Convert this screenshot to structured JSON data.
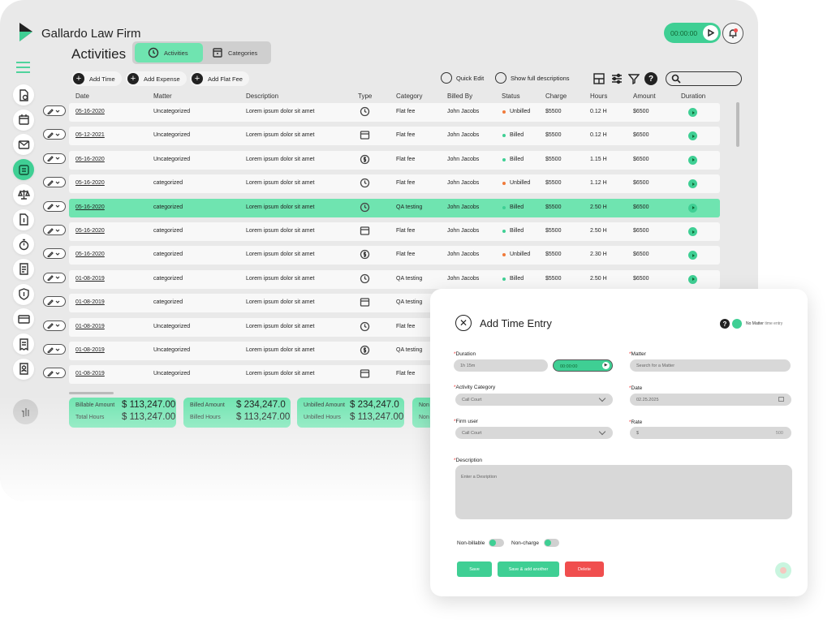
{
  "app": {
    "firm_name": "Gallardo Law Firm",
    "page_title": "Activities"
  },
  "tabs": [
    {
      "label": "Activities",
      "icon": "clock-refresh-icon",
      "active": true
    },
    {
      "label": "Categories",
      "icon": "archive-icon",
      "active": false
    }
  ],
  "timer": {
    "value": "00:00:00"
  },
  "sidebar": {
    "icons": [
      "file-clock-icon",
      "calendar-icon",
      "mail-icon",
      "activities-icon",
      "scales-icon",
      "file-dollar-icon",
      "stopwatch-icon",
      "document-icon",
      "shield-dollar-icon",
      "card-dollar-icon",
      "invoice-icon",
      "file-user-icon"
    ],
    "active_index": 3
  },
  "toolbar": {
    "add_time": "Add Time",
    "add_expense": "Add Expense",
    "add_flat_fee": "Add Flat Fee",
    "quick_edit": "Quick Edit",
    "show_full": "Show full descriptions",
    "search_placeholder": ""
  },
  "columns": [
    "Date",
    "Matter",
    "Description",
    "Type",
    "Category",
    "Billed By",
    "Status",
    "Charge",
    "Hours",
    "Amount",
    "Duration"
  ],
  "rows": [
    {
      "date": "05-16-2020",
      "matter": "Uncategorized",
      "description": "Lorem ipsum dolor sit amet",
      "type": "history",
      "category": "Flat fee",
      "billed_by": "John Jacobs",
      "status": "Unbilled",
      "charge": "$5500",
      "hours": "0.12 H",
      "amount": "$6500"
    },
    {
      "date": "05-12-2021",
      "matter": "Uncategorized",
      "description": "Lorem ipsum dolor sit amet",
      "type": "archive",
      "category": "Flat fee",
      "billed_by": "John Jacobs",
      "status": "Billed",
      "charge": "$5500",
      "hours": "0.12 H",
      "amount": "$6500"
    },
    {
      "date": "05-16-2020",
      "matter": "Uncategorized",
      "description": "Lorem ipsum dolor sit amet",
      "type": "dollar",
      "category": "Flat fee",
      "billed_by": "John Jacobs",
      "status": "Billed",
      "charge": "$5500",
      "hours": "1.15 H",
      "amount": "$6500"
    },
    {
      "date": "05-16-2020",
      "matter": "categorized",
      "description": "Lorem ipsum dolor sit amet",
      "type": "history",
      "category": "Flat fee",
      "billed_by": "John Jacobs",
      "status": "Unbilled",
      "charge": "$5500",
      "hours": "1.12 H",
      "amount": "$6500"
    },
    {
      "date": "05-16-2020",
      "matter": "categorized",
      "description": "Lorem ipsum dolor sit amet",
      "type": "history",
      "category": "QA testing",
      "billed_by": "John Jacobs",
      "status": "Billed",
      "charge": "$5500",
      "hours": "2.50 H",
      "amount": "$6500"
    },
    {
      "date": "05-16-2020",
      "matter": "categorized",
      "description": "Lorem ipsum dolor sit amet",
      "type": "archive",
      "category": "Flat fee",
      "billed_by": "John Jacobs",
      "status": "Billed",
      "charge": "$5500",
      "hours": "2.50 H",
      "amount": "$6500"
    },
    {
      "date": "05-16-2020",
      "matter": "categorized",
      "description": "Lorem ipsum dolor sit amet",
      "type": "dollar",
      "category": "Flat fee",
      "billed_by": "John Jacobs",
      "status": "Unbilled",
      "charge": "$5500",
      "hours": "2.30 H",
      "amount": "$6500"
    },
    {
      "date": "01-08-2019",
      "matter": "categorized",
      "description": "Lorem ipsum dolor sit amet",
      "type": "history",
      "category": "QA testing",
      "billed_by": "John Jacobs",
      "status": "Billed",
      "charge": "$5500",
      "hours": "2.50 H",
      "amount": "$6500"
    },
    {
      "date": "01-08-2019",
      "matter": "categorized",
      "description": "Lorem ipsum dolor sit amet",
      "type": "archive",
      "category": "QA testing",
      "billed_by": "",
      "status": "",
      "charge": "",
      "hours": "",
      "amount": ""
    },
    {
      "date": "01-08-2019",
      "matter": "Uncategorized",
      "description": "Lorem ipsum dolor sit amet",
      "type": "history",
      "category": "Flat fee",
      "billed_by": "",
      "status": "",
      "charge": "",
      "hours": "",
      "amount": ""
    },
    {
      "date": "01-08-2019",
      "matter": "Uncategorized",
      "description": "Lorem ipsum dolor sit amet",
      "type": "dollar",
      "category": "QA testing",
      "billed_by": "",
      "status": "",
      "charge": "",
      "hours": "",
      "amount": ""
    },
    {
      "date": "01-08-2019",
      "matter": "Uncategorized",
      "description": "Lorem ipsum dolor sit amet",
      "type": "archive",
      "category": "Flat fee",
      "billed_by": "",
      "status": "",
      "charge": "",
      "hours": "",
      "amount": ""
    }
  ],
  "selected_row": 4,
  "summary": [
    {
      "label1": "Billable Amount",
      "value1": "$ 113,247.00",
      "label2": "Total Hours",
      "value2": "$ 113,247.00"
    },
    {
      "label1": "Billed Amount",
      "value1": "$ 234,247.0",
      "label2": "Billed Hours",
      "value2": "$ 113,247.00"
    },
    {
      "label1": "Unbilled Amount",
      "value1": "$ 234,247.0",
      "label2": "Unbilled Hours",
      "value2": "$ 113,247.00"
    },
    {
      "label1": "Non",
      "value1": "",
      "label2": "Non",
      "value2": ""
    }
  ],
  "modal": {
    "title": "Add Time Entry",
    "no_matter": "No Matter",
    "no_matter_suffix": "time entry",
    "duration_label": "Duration",
    "duration_value": "1h 15m",
    "duration_timer": "00:00:00",
    "matter_label": "Matter",
    "matter_placeholder": "Search for a Matter",
    "activity_category_label": "Activity Category",
    "activity_category_value": "Call Court",
    "date_label": "Date",
    "date_value": "02.25.2025",
    "firm_user_label": "Firm user",
    "firm_user_value": "Call Court",
    "rate_label": "Rate",
    "rate_prefix": "$",
    "rate_value": "500",
    "description_label": "Description",
    "description_placeholder": "Enter a Desription",
    "non_billable": "Non-billable",
    "non_charge": "Non-charge",
    "save": "Save",
    "save_add": "Save & add another",
    "delete": "Delete"
  },
  "colors": {
    "accent": "#3fcf94",
    "accent_light": "#6fe4b0",
    "billed": "#3fcf94",
    "unbilled": "#f07a3a",
    "delete": "#f04e4e"
  }
}
